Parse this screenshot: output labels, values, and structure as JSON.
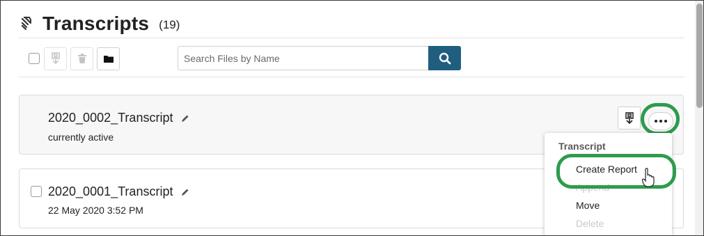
{
  "header": {
    "title": "Transcripts",
    "count": "(19)",
    "icon": "transcript-icon"
  },
  "toolbar": {
    "download_icon": "download-icon",
    "delete_icon": "trash-icon",
    "move_icon": "folder-icon"
  },
  "search": {
    "placeholder": "Search Files by Name",
    "value": "",
    "button_icon": "search-icon",
    "button_color": "#1f5e7e"
  },
  "files": [
    {
      "name": "2020_0002_Transcript",
      "subtitle": "currently active"
    },
    {
      "name": "2020_0001_Transcript",
      "subtitle": "22 May 2020 3:52 PM"
    }
  ],
  "context_menu": {
    "header": "Transcript",
    "items": [
      {
        "label": "Create Report",
        "enabled": true
      },
      {
        "label": "Append",
        "enabled": false
      },
      {
        "label": "Move",
        "enabled": true
      },
      {
        "label": "Delete",
        "enabled": false
      }
    ]
  },
  "highlight_color": "#2e9b4e"
}
